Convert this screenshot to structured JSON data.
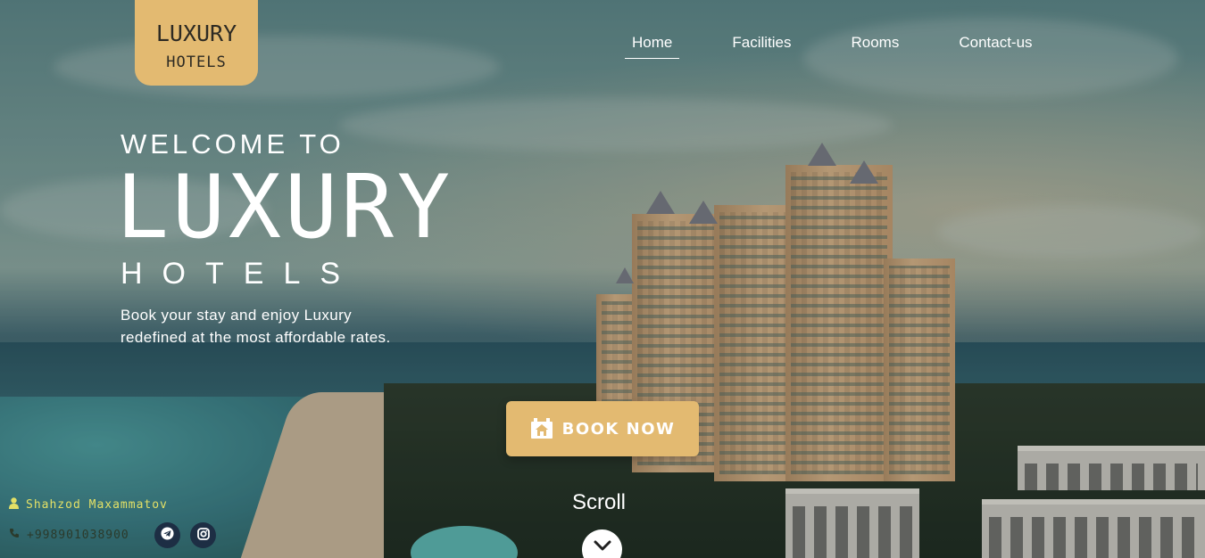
{
  "logo": {
    "line1": "LUXURY",
    "line2": "HOTELS"
  },
  "nav": {
    "items": [
      {
        "label": "Home",
        "active": true
      },
      {
        "label": "Facilities",
        "active": false
      },
      {
        "label": "Rooms",
        "active": false
      },
      {
        "label": "Contact-us",
        "active": false
      }
    ]
  },
  "hero": {
    "welcome": "WELCOME TO",
    "title": "LUXURY",
    "subtitle": "HOTELS",
    "tagline_line1": "Book your stay and enjoy Luxury",
    "tagline_line2": "redefined at the most affordable rates.",
    "book_label": "BOOK NOW",
    "scroll_label": "Scroll"
  },
  "footer": {
    "author": "Shahzod Maxammatov",
    "phone": "+998901038900"
  },
  "colors": {
    "accent": "#e3ba71",
    "author": "#e3e066",
    "social_bg": "#1d2e44"
  },
  "icons": [
    "hotel-icon",
    "chevron-down-icon",
    "user-icon",
    "phone-icon",
    "telegram-icon",
    "instagram-icon"
  ]
}
